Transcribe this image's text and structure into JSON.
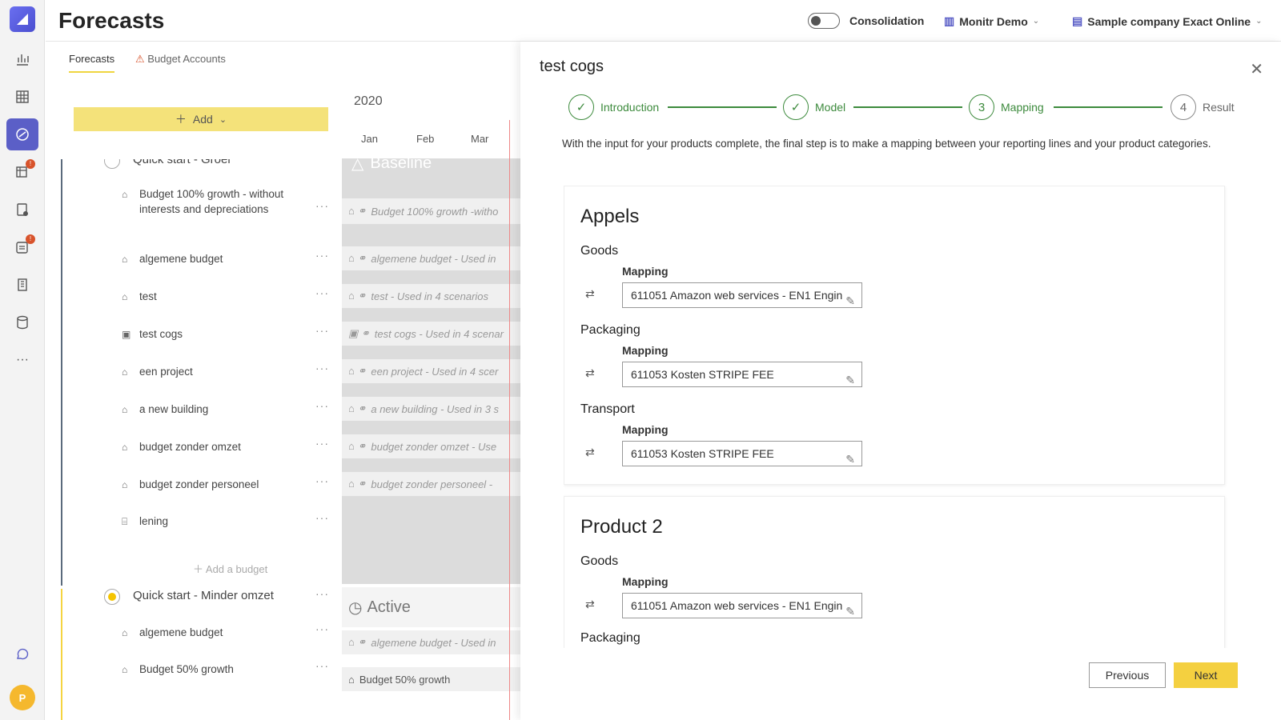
{
  "header": {
    "title": "Forecasts",
    "consolidation_label": "Consolidation",
    "org": "Monitr Demo",
    "company": "Sample company Exact Online"
  },
  "tabs": [
    {
      "label": "Forecasts"
    },
    {
      "label": "Budget Accounts"
    }
  ],
  "left": {
    "add_label": "Add",
    "year": "2020",
    "months": [
      "Jan",
      "Feb",
      "Mar"
    ],
    "group1": "Quick start - Groei",
    "group1_block_label": "Baseline",
    "budgets": [
      {
        "name": "Budget 100% growth - without interests and depreciations",
        "timeline": "Budget 100% growth -witho"
      },
      {
        "name": "algemene budget",
        "timeline": "algemene budget - Used in"
      },
      {
        "name": "test",
        "timeline": "test - Used in 4 scenarios"
      },
      {
        "name": "test cogs",
        "timeline": "test cogs - Used in 4 scenar"
      },
      {
        "name": "een project",
        "timeline": "een project - Used in 4 scer"
      },
      {
        "name": "a new building",
        "timeline": "a new building - Used in 3 s"
      },
      {
        "name": "budget zonder omzet",
        "timeline": "budget zonder omzet - Use"
      },
      {
        "name": "budget zonder personeel",
        "timeline": "budget zonder personeel -"
      },
      {
        "name": "lening",
        "timeline": ""
      }
    ],
    "add_budget": "Add a budget",
    "group2": "Quick start - Minder omzet",
    "group2_block_label": "Active",
    "budgets2": [
      {
        "name": "algemene budget",
        "timeline": "algemene budget - Used in"
      },
      {
        "name": "Budget 50% growth",
        "timeline": "Budget 50% growth"
      }
    ]
  },
  "panel": {
    "title": "test cogs",
    "steps": [
      {
        "num": "✓",
        "label": "Introduction"
      },
      {
        "num": "✓",
        "label": "Model"
      },
      {
        "num": "3",
        "label": "Mapping"
      },
      {
        "num": "4",
        "label": "Result"
      }
    ],
    "intro": "With the input for your products complete, the final step is to make a mapping between your reporting lines and your product categories.",
    "mapping_label": "Mapping",
    "cards": [
      {
        "title": "Appels",
        "sections": [
          {
            "name": "Goods",
            "value": "611051 Amazon web services - EN1 Engin"
          },
          {
            "name": "Packaging",
            "value": "611053 Kosten STRIPE FEE"
          },
          {
            "name": "Transport",
            "value": "611053 Kosten STRIPE FEE"
          }
        ]
      },
      {
        "title": "Product 2",
        "sections": [
          {
            "name": "Goods",
            "value": "611051 Amazon web services - EN1 Engin"
          },
          {
            "name": "Packaging",
            "value": ""
          }
        ]
      }
    ],
    "prev_label": "Previous",
    "next_label": "Next"
  },
  "avatar_initial": "P",
  "colors": {
    "accent": "#5b5fc7",
    "yellow": "#f4d040",
    "green": "#3c8a3c"
  }
}
